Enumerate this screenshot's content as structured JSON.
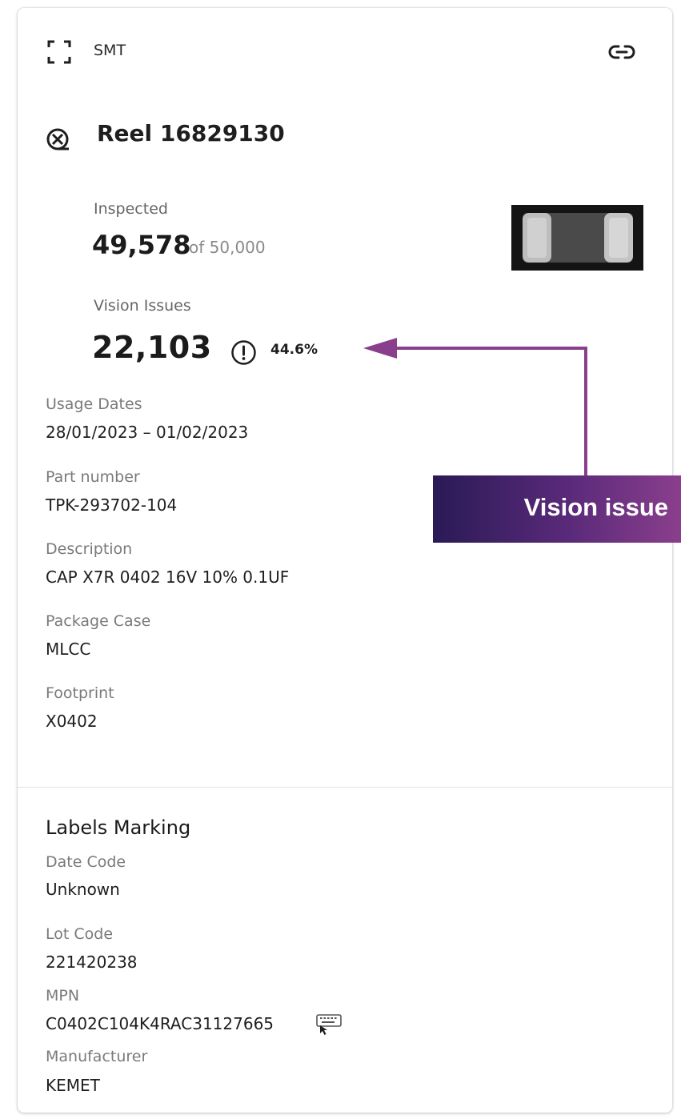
{
  "header": {
    "category": "SMT"
  },
  "reel": {
    "title": "Reel 16829130"
  },
  "inspected": {
    "label": "Inspected",
    "value": "49,578",
    "of_text": "of 50,000"
  },
  "vision_issues": {
    "label": "Vision Issues",
    "value": "22,103",
    "percent": "44.6%"
  },
  "details": [
    {
      "label": "Usage Dates",
      "value": "28/01/2023 – 01/02/2023"
    },
    {
      "label": "Part number",
      "value": "TPK-293702-104"
    },
    {
      "label": "Description",
      "value": "CAP X7R 0402 16V 10% 0.1UF"
    },
    {
      "label": "Package Case",
      "value": "MLCC"
    },
    {
      "label": "Footprint",
      "value": "X0402"
    }
  ],
  "labels_marking": {
    "title": "Labels Marking",
    "fields": [
      {
        "label": "Date Code",
        "value": "Unknown"
      },
      {
        "label": "Lot Code",
        "value": "221420238"
      },
      {
        "label": "MPN",
        "value": "C0402C104K4RAC31127665"
      },
      {
        "label": "Manufacturer",
        "value": "KEMET"
      }
    ]
  },
  "callout": {
    "text": "Vision issue",
    "color": "#8a3f8c"
  },
  "icons": {
    "scan": "scan-frame-icon",
    "link": "link-icon",
    "reel": "reel-icon",
    "alert": "alert-circle-icon",
    "keyboard": "keyboard-icon"
  }
}
